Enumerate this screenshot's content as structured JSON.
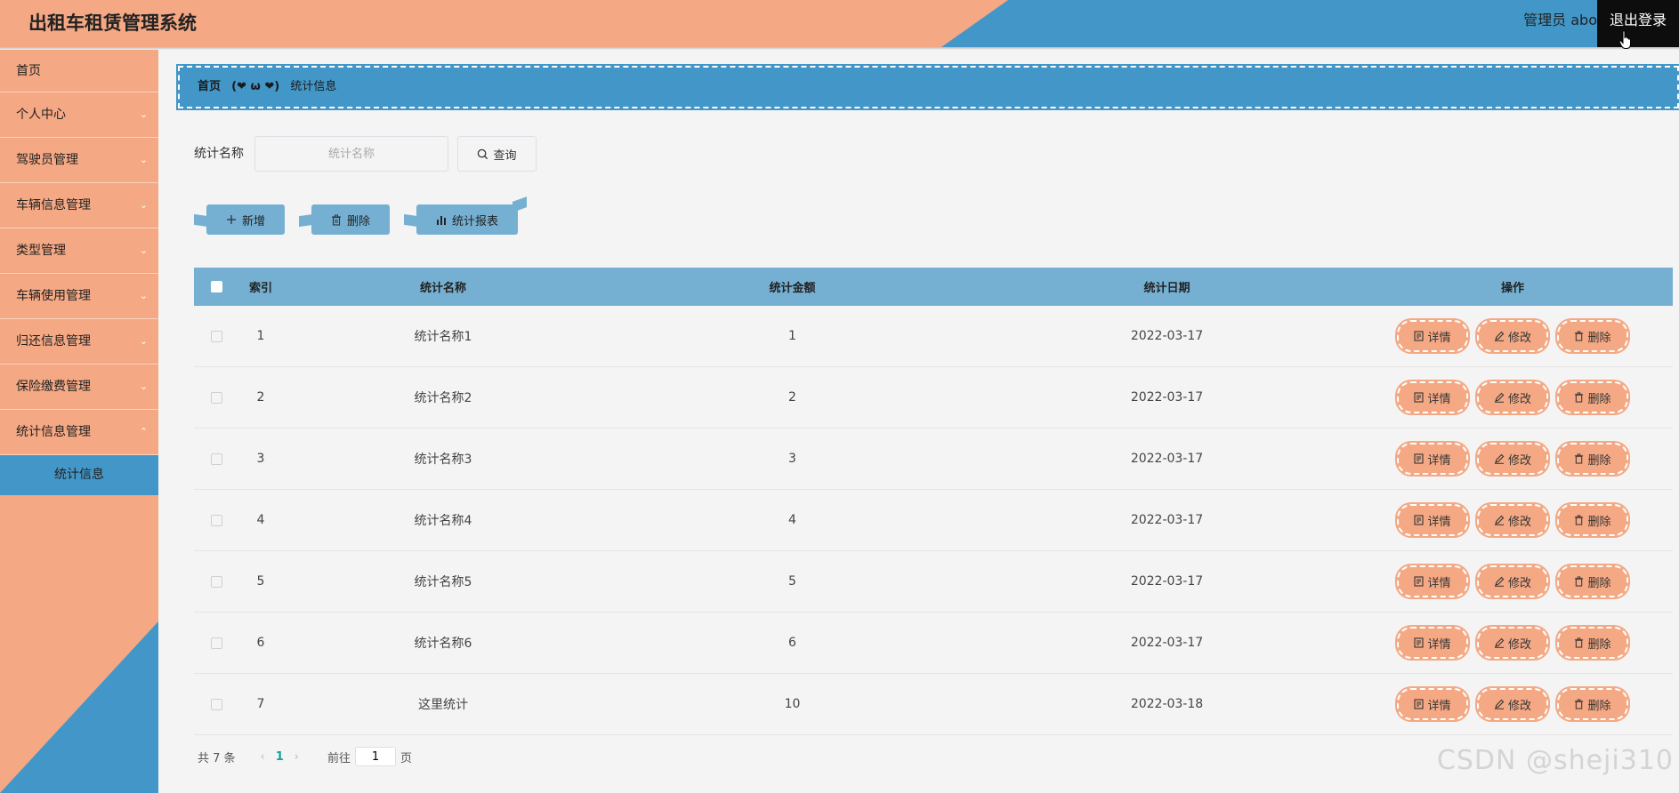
{
  "header": {
    "title": "出租车租赁管理系统",
    "user": "管理员 abo",
    "logout": "退出登录"
  },
  "sidebar": {
    "items": [
      {
        "label": "首页"
      },
      {
        "label": "个人中心"
      },
      {
        "label": "驾驶员管理"
      },
      {
        "label": "车辆信息管理"
      },
      {
        "label": "类型管理"
      },
      {
        "label": "车辆使用管理"
      },
      {
        "label": "归还信息管理"
      },
      {
        "label": "保险缴费管理"
      },
      {
        "label": "统计信息管理"
      }
    ],
    "active_sub": "统计信息"
  },
  "breadcrumb": {
    "home": "首页",
    "separator": "(❤ ω ❤)",
    "current": "统计信息"
  },
  "search": {
    "label": "统计名称",
    "placeholder": "统计名称",
    "button": "查询"
  },
  "actions": {
    "add": "新增",
    "delete": "删除",
    "report": "统计报表"
  },
  "table": {
    "headers": [
      "索引",
      "统计名称",
      "统计金额",
      "统计日期",
      "操作"
    ],
    "rows": [
      {
        "index": "1",
        "name": "统计名称1",
        "amount": "1",
        "date": "2022-03-17"
      },
      {
        "index": "2",
        "name": "统计名称2",
        "amount": "2",
        "date": "2022-03-17"
      },
      {
        "index": "3",
        "name": "统计名称3",
        "amount": "3",
        "date": "2022-03-17"
      },
      {
        "index": "4",
        "name": "统计名称4",
        "amount": "4",
        "date": "2022-03-17"
      },
      {
        "index": "5",
        "name": "统计名称5",
        "amount": "5",
        "date": "2022-03-17"
      },
      {
        "index": "6",
        "name": "统计名称6",
        "amount": "6",
        "date": "2022-03-17"
      },
      {
        "index": "7",
        "name": "这里统计",
        "amount": "10",
        "date": "2022-03-18"
      }
    ],
    "ops": {
      "detail": "详情",
      "edit": "修改",
      "delete": "删除"
    }
  },
  "pagination": {
    "total": "共 7 条",
    "current_page": "1",
    "goto_label": "前往",
    "goto_value": "1",
    "page_suffix": "页"
  },
  "watermark": "CSDN @sheji310",
  "colors": {
    "peach": "#f4a884",
    "blue": "#4397c8",
    "light_blue": "#75b0d3",
    "page_bg": "#f4f4f4"
  }
}
